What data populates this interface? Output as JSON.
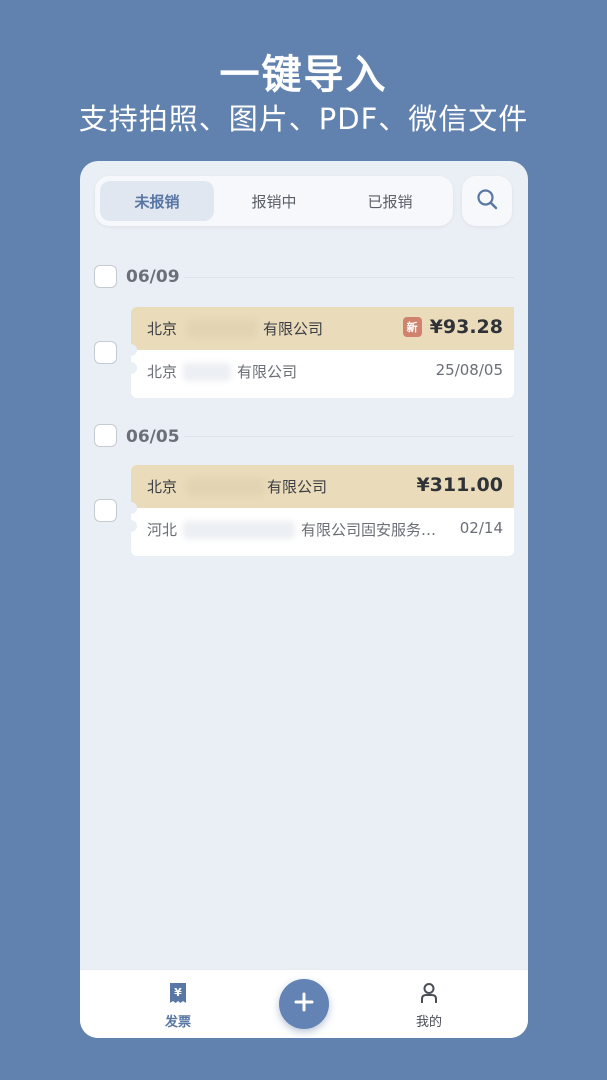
{
  "promo": {
    "title": "一键导入",
    "subtitle": "支持拍照、图片、PDF、微信文件"
  },
  "tabs": [
    {
      "label": "未报销",
      "active": true
    },
    {
      "label": "报销中",
      "active": false
    },
    {
      "label": "已报销",
      "active": false
    }
  ],
  "groups": [
    {
      "date": "06/09",
      "invoices": [
        {
          "seller_prefix": "北京",
          "seller_suffix": "有限公司",
          "badge": "新",
          "amount": "¥93.28",
          "buyer_prefix": "北京",
          "buyer_suffix": "有限公司",
          "date": "25/08/05"
        }
      ]
    },
    {
      "date": "06/05",
      "invoices": [
        {
          "seller_prefix": "北京",
          "seller_suffix": "有限公司",
          "amount": "¥311.00",
          "buyer_prefix": "河北",
          "buyer_suffix": "有限公司固安服务…",
          "date": "02/14"
        }
      ]
    }
  ],
  "bottom_nav": {
    "invoices_label": "发票",
    "mine_label": "我的",
    "active_color": "#5877a4"
  },
  "colors": {
    "background": "#6182ae",
    "accent": "#6283b3",
    "ticket_header": "#eadcba",
    "badge": "#d0826e"
  }
}
